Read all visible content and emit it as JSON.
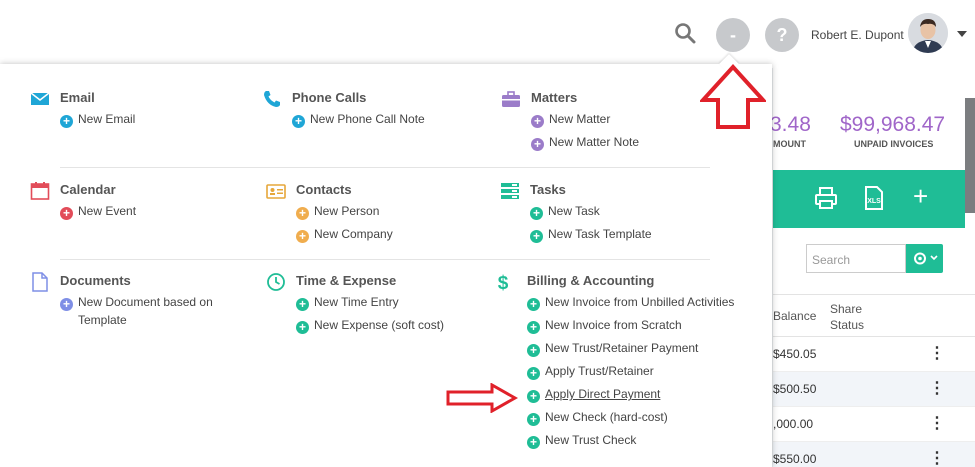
{
  "header": {
    "user_name": "Robert E. Dupont",
    "minus_glyph": "-",
    "help_glyph": "?"
  },
  "colors": {
    "teal": "#1fbd96",
    "red": "#e24c59",
    "orange": "#f0ad4e",
    "purple": "#9b7cc9",
    "blue_dot": "#1fa6d6",
    "lavender": "#7f8fe6",
    "annotation_arrow": "#e0212a"
  },
  "menu": {
    "email": {
      "title": "Email",
      "items": [
        "New Email"
      ]
    },
    "phone": {
      "title": "Phone Calls",
      "items": [
        "New Phone Call Note"
      ]
    },
    "matters": {
      "title": "Matters",
      "items": [
        "New Matter",
        "New Matter Note"
      ]
    },
    "calendar": {
      "title": "Calendar",
      "items": [
        "New Event"
      ]
    },
    "contacts": {
      "title": "Contacts",
      "items": [
        "New Person",
        "New Company"
      ]
    },
    "tasks": {
      "title": "Tasks",
      "items": [
        "New Task",
        "New Task Template"
      ]
    },
    "documents": {
      "title": "Documents",
      "items": [
        "New Document based on",
        "Template"
      ]
    },
    "time": {
      "title": "Time & Expense",
      "items": [
        "New Time Entry",
        "New Expense (soft cost)"
      ]
    },
    "billing": {
      "title": "Billing & Accounting",
      "items": [
        "New Invoice from Unbilled Activities",
        "New Invoice from Scratch",
        "New Trust/Retainer Payment",
        "Apply Trust/Retainer",
        "Apply Direct Payment",
        "New Check (hard-cost)",
        "New Trust Check"
      ]
    }
  },
  "background": {
    "kpi1_value": "3.48",
    "kpi1_label": "MOUNT",
    "kpi2_value": "$99,968.47",
    "kpi2_label": "UNPAID INVOICES",
    "search_placeholder": "Search",
    "col_balance": "Balance",
    "col_share": "Share Status",
    "rows": [
      "$450.05",
      "$500.50",
      ",000.00",
      "$550.00"
    ]
  }
}
